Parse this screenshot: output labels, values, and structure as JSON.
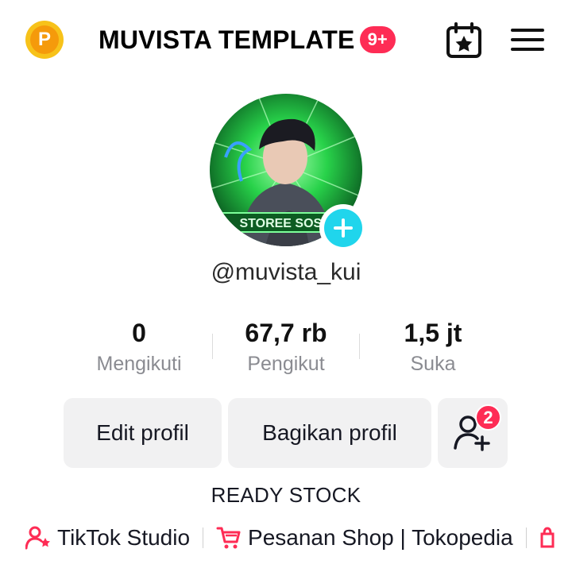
{
  "header": {
    "coin_letter": "P",
    "title": "MUVISTA TEMPLATE",
    "notification_badge": "9+",
    "icons": [
      "coin-icon",
      "calendar-star-icon",
      "hamburger-menu-icon"
    ]
  },
  "profile": {
    "avatar_text": "STOREE SOSM",
    "username": "@muvista_kui"
  },
  "stats": [
    {
      "value": "0",
      "label": "Mengikuti"
    },
    {
      "value": "67,7 rb",
      "label": "Pengikut"
    },
    {
      "value": "1,5 jt",
      "label": "Suka"
    }
  ],
  "actions": {
    "edit_label": "Edit profil",
    "share_label": "Bagikan profil",
    "friend_badge": "2"
  },
  "bio": "READY STOCK",
  "links": [
    {
      "label": "TikTok Studio",
      "icon": "person-star-icon"
    },
    {
      "label": "Pesanan Shop | Tokopedia",
      "icon": "cart-icon"
    }
  ],
  "colors": {
    "accent_red": "#fe2c55",
    "accent_cyan": "#20d5ec",
    "coin_gold": "#f7c21a"
  }
}
